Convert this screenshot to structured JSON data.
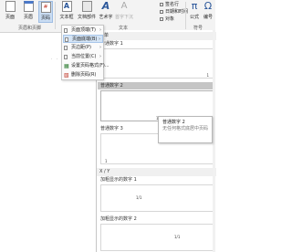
{
  "ribbon": {
    "buttons": [
      {
        "id": "page",
        "label": "页面"
      },
      {
        "id": "header",
        "label": "页眉"
      },
      {
        "id": "pagenum",
        "label": "页码"
      },
      {
        "id": "textbox",
        "label": "文本框"
      },
      {
        "id": "docparts",
        "label": "文档部件"
      },
      {
        "id": "wordart",
        "label": "艺术字"
      },
      {
        "id": "dropcap",
        "label": "首字下沉"
      },
      {
        "id": "formula",
        "label": "公式"
      },
      {
        "id": "symbol",
        "label": "编号"
      }
    ],
    "small_items": [
      "签名行",
      "日期和时间",
      "对象"
    ],
    "groups": {
      "header_footer": "页眉和页脚",
      "text": "文本",
      "symbols": "符号"
    }
  },
  "menu": {
    "items": [
      {
        "label": "页面顶端(T)",
        "has_arrow": true
      },
      {
        "label": "页面底端(B)",
        "has_arrow": true
      },
      {
        "label": "页边距(P)",
        "has_arrow": true
      },
      {
        "label": "当前位置(C)",
        "has_arrow": true
      },
      {
        "label": "设置页码格式(F)...",
        "has_arrow": false
      },
      {
        "label": "删除页码(R)",
        "has_arrow": false
      }
    ]
  },
  "gallery": {
    "section_header": "简单",
    "items": [
      {
        "name": "普通数字 1",
        "num": "1"
      },
      {
        "name": "普通数字 2",
        "num": "1"
      },
      {
        "name": "普通数字 3",
        "num": "1"
      }
    ],
    "section2_header": "X / Y",
    "items2": [
      {
        "name": "加粗显示的数字 1",
        "num": "1/1"
      },
      {
        "name": "加粗显示的数字 2",
        "num": "1/1"
      }
    ]
  },
  "tooltip": {
    "title": "普通数字 2",
    "description": "无任何格式底居中页码"
  }
}
